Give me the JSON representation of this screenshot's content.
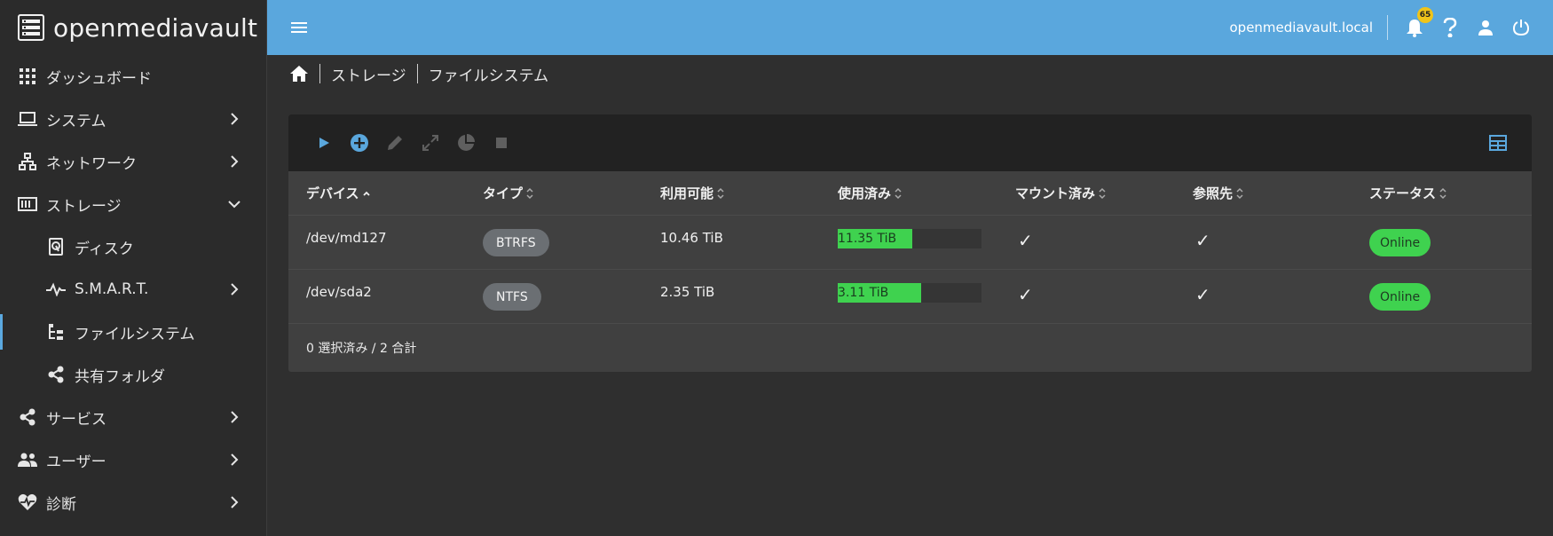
{
  "brand": {
    "name": "openmediavault"
  },
  "sidebar": {
    "items": [
      {
        "label": "ダッシュボード",
        "icon": "dashboard-grid-icon"
      },
      {
        "label": "システム",
        "icon": "laptop-icon"
      },
      {
        "label": "ネットワーク",
        "icon": "network-icon"
      },
      {
        "label": "ストレージ",
        "icon": "storage-icon",
        "expanded": true
      },
      {
        "label": "ディスク",
        "icon": "disk-icon"
      },
      {
        "label": "S.M.A.R.T.",
        "icon": "pulse-icon"
      },
      {
        "label": "ファイルシステム",
        "icon": "file-tree-icon",
        "active": true
      },
      {
        "label": "共有フォルダ",
        "icon": "share-icon"
      },
      {
        "label": "サービス",
        "icon": "share-icon"
      },
      {
        "label": "ユーザー",
        "icon": "users-icon"
      },
      {
        "label": "診断",
        "icon": "heart-pulse-icon"
      }
    ]
  },
  "topbar": {
    "hostname": "openmediavault.local",
    "notification_count": "65"
  },
  "breadcrumb": {
    "items": [
      "ストレージ",
      "ファイルシステム"
    ]
  },
  "table": {
    "columns": [
      "デバイス",
      "タイプ",
      "利用可能",
      "使用済み",
      "マウント済み",
      "参照先",
      "ステータス"
    ],
    "rows": [
      {
        "device": "/dev/md127",
        "type": "BTRFS",
        "available": "10.46 TiB",
        "used": "11.35 TiB",
        "used_fraction": 0.52,
        "mounted": "✓",
        "referenced": "✓",
        "status": "Online"
      },
      {
        "device": "/dev/sda2",
        "type": "NTFS",
        "available": "2.35 TiB",
        "used": "3.11 TiB",
        "used_fraction": 0.58,
        "mounted": "✓",
        "referenced": "✓",
        "status": "Online"
      }
    ],
    "footer": "0 選択済み / 2 合計"
  },
  "colors": {
    "topbar": "#5aa7dd",
    "accent": "#5ba9e0",
    "online": "#3fd24f",
    "badge": "#f0c419"
  }
}
